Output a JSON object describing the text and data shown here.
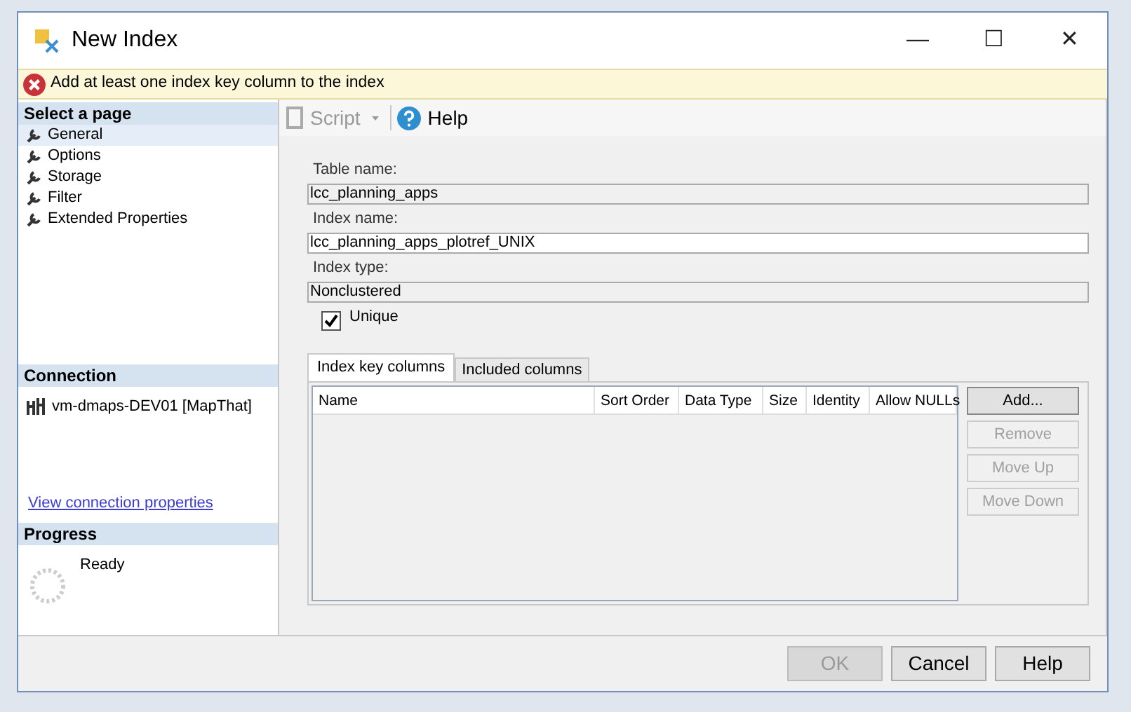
{
  "window": {
    "title": "New Index",
    "controls": [
      "—",
      "☐",
      "✕"
    ]
  },
  "error": {
    "message": "Add at least one index key column to the index"
  },
  "sidebar": {
    "select_page": {
      "heading": "Select a page",
      "items": [
        {
          "label": "General",
          "selected": true
        },
        {
          "label": "Options",
          "selected": false
        },
        {
          "label": "Storage",
          "selected": false
        },
        {
          "label": "Filter",
          "selected": false
        },
        {
          "label": "Extended Properties",
          "selected": false
        }
      ]
    },
    "connection": {
      "heading": "Connection",
      "server": "vm-dmaps-DEV01 [MapThat]",
      "link": "View connection properties"
    },
    "progress": {
      "heading": "Progress",
      "status": "Ready"
    }
  },
  "toolbar": {
    "script": {
      "label": "Script",
      "disabled": true
    },
    "help": "Help"
  },
  "form": {
    "fields": [
      {
        "label": "Table name:",
        "value": "lcc_planning_apps",
        "disabled": true
      },
      {
        "label": "Index name:",
        "value": "lcc_planning_apps_plotref_UNIX",
        "disabled": false
      },
      {
        "label": "Index type:",
        "value": "Nonclustered",
        "disabled": true
      }
    ],
    "unique": {
      "label": "Unique",
      "checked": true
    }
  },
  "tabs": [
    {
      "label": "Index key columns",
      "selected": true
    },
    {
      "label": "Included columns",
      "selected": false
    }
  ],
  "table": {
    "columns": [
      "Name",
      "Sort Order",
      "Data Type",
      "Size",
      "Identity",
      "Allow NULLs"
    ]
  },
  "side_buttons": [
    {
      "label": "Add...",
      "disabled": false
    },
    {
      "label": "Remove",
      "disabled": true
    },
    {
      "label": "Move Up",
      "disabled": true
    },
    {
      "label": "Move Down",
      "disabled": true
    }
  ],
  "buttons": [
    {
      "label": "OK",
      "disabled": true
    },
    {
      "label": "Cancel",
      "disabled": false
    },
    {
      "label": "Help",
      "disabled": false
    }
  ]
}
